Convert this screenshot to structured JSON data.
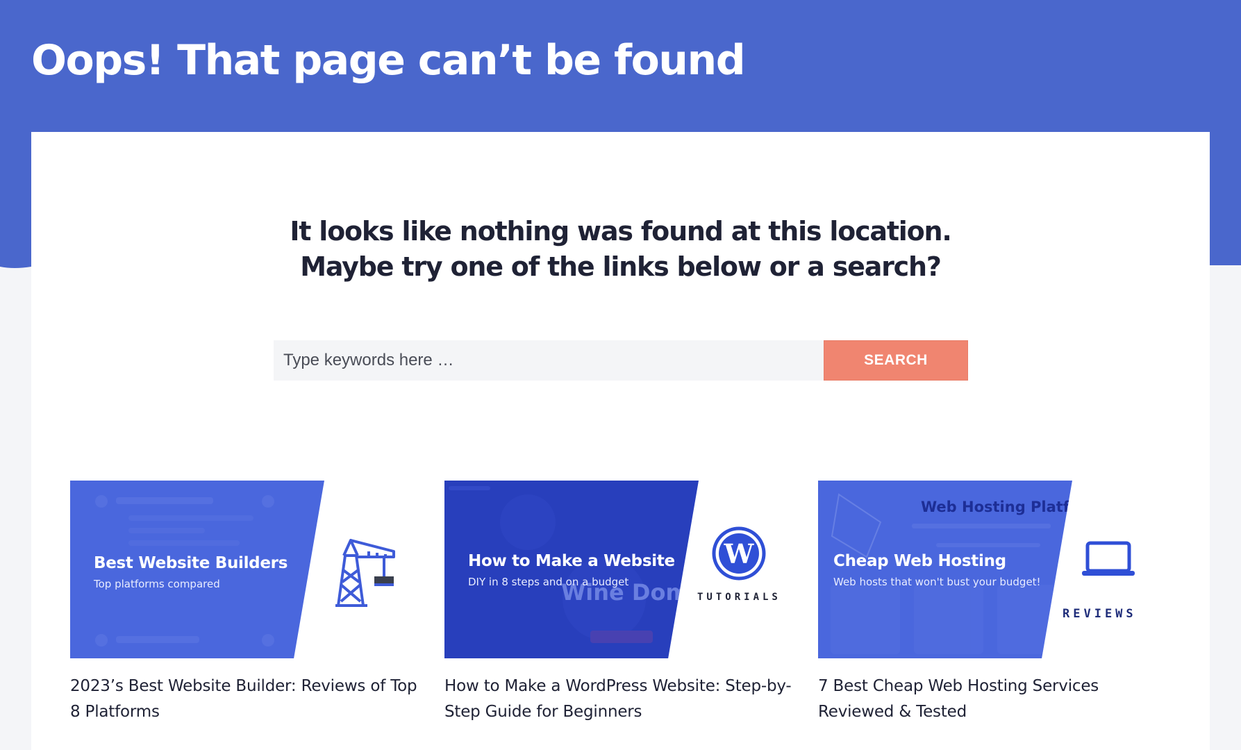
{
  "header": {
    "title": "Oops! That page can’t be found"
  },
  "content": {
    "message_line1": "It looks like nothing was found at this location.",
    "message_line2": "Maybe try one of the links below or a search?"
  },
  "search": {
    "placeholder": "Type keywords here …",
    "button_label": "SEARCH"
  },
  "posts": [
    {
      "thumb_title": "Best Website Builders",
      "thumb_subtitle": "Top platforms compared",
      "icon": "crane-icon",
      "title": "2023’s Best Website Builder: Reviews of Top 8 Platforms"
    },
    {
      "thumb_title": "How to Make a Website",
      "thumb_subtitle": "DIY in 8 steps and on a budget",
      "thumb_bg_text": "Wine Dom",
      "icon": "wordpress-icon",
      "tag": "TUTORIALS",
      "title": "How to Make a WordPress Website: Step-by-Step Guide for Beginners"
    },
    {
      "thumb_title": "Cheap Web Hosting",
      "thumb_subtitle": "Web hosts that won't bust your budget!",
      "thumb_bg_text": "Web Hosting Platforr",
      "icon": "laptop-icon",
      "tag": "REVIEWS",
      "title": "7 Best Cheap Web Hosting Services Reviewed & Tested"
    }
  ],
  "colors": {
    "brand_blue": "#4a67cc",
    "search_button": "#f08570",
    "text_dark": "#1f2235"
  }
}
